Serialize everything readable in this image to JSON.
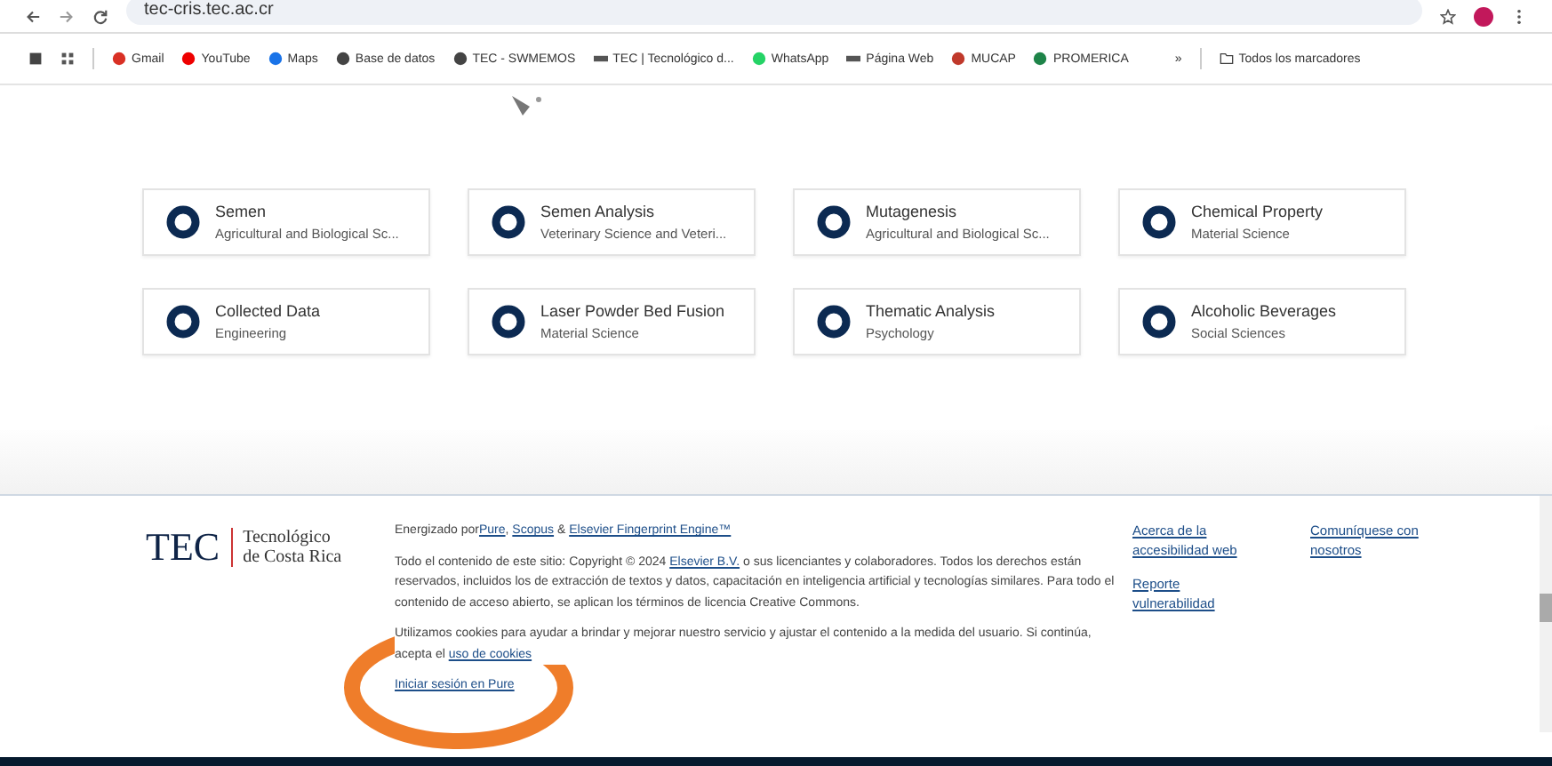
{
  "browser": {
    "url": "tec-cris.tec.ac.cr",
    "bookmarks": [
      "Gmail",
      "YouTube",
      "Maps",
      "Base de datos",
      "TEC - SWMEMOS",
      "TEC | Tecnológico d...",
      "WhatsApp",
      "Página Web",
      "MUCAP",
      "PROMERICA"
    ],
    "more": "»",
    "all_bookmarks": "Todos los marcadores"
  },
  "concepts": [
    {
      "name": "Semen",
      "area": "Agricultural and Biological Sc..."
    },
    {
      "name": "Semen Analysis",
      "area": "Veterinary Science and Veteri..."
    },
    {
      "name": "Mutagenesis",
      "area": "Agricultural and Biological Sc..."
    },
    {
      "name": "Chemical Property",
      "area": "Material Science"
    },
    {
      "name": "Collected Data",
      "area": "Engineering"
    },
    {
      "name": "Laser Powder Bed Fusion",
      "area": "Material Science"
    },
    {
      "name": "Thematic Analysis",
      "area": "Psychology"
    },
    {
      "name": "Alcoholic Beverages",
      "area": "Social Sciences"
    }
  ],
  "footer": {
    "logo_mark": "TEC",
    "logo_text": [
      "Tecnológico",
      "de Costa Rica"
    ],
    "powered_prefix": "Energizado por",
    "powered_links": [
      "Pure",
      "Scopus",
      "Elsevier Fingerprint Engine™"
    ],
    "powered_separators": [
      ",",
      "&"
    ],
    "copyright_prefix": "Todo el contenido de este sitio: Copyright © 2024 ",
    "copyright_link": "Elsevier B.V.",
    "copyright_rest": " o sus licenciantes y colaboradores. Todos los derechos están reservados, incluidos los de extracción de textos y datos, capacitación en inteligencia artificial y tecnologías similares. Para todo el contenido de acceso abierto, se aplican los términos de licencia Creative Commons.",
    "cookies_prefix": "Utilizamos cookies para ayudar a brindar y mejorar nuestro servicio y ajustar el contenido a la medida del usuario. Si continúa, acepta el ",
    "cookies_link": "uso de cookies",
    "login": "Iniciar sesión en Pure",
    "links": [
      [
        "Acerca de la accesibilidad web",
        "Reporte vulnerabilidad"
      ],
      [
        "Comuníquese con nosotros"
      ]
    ]
  }
}
